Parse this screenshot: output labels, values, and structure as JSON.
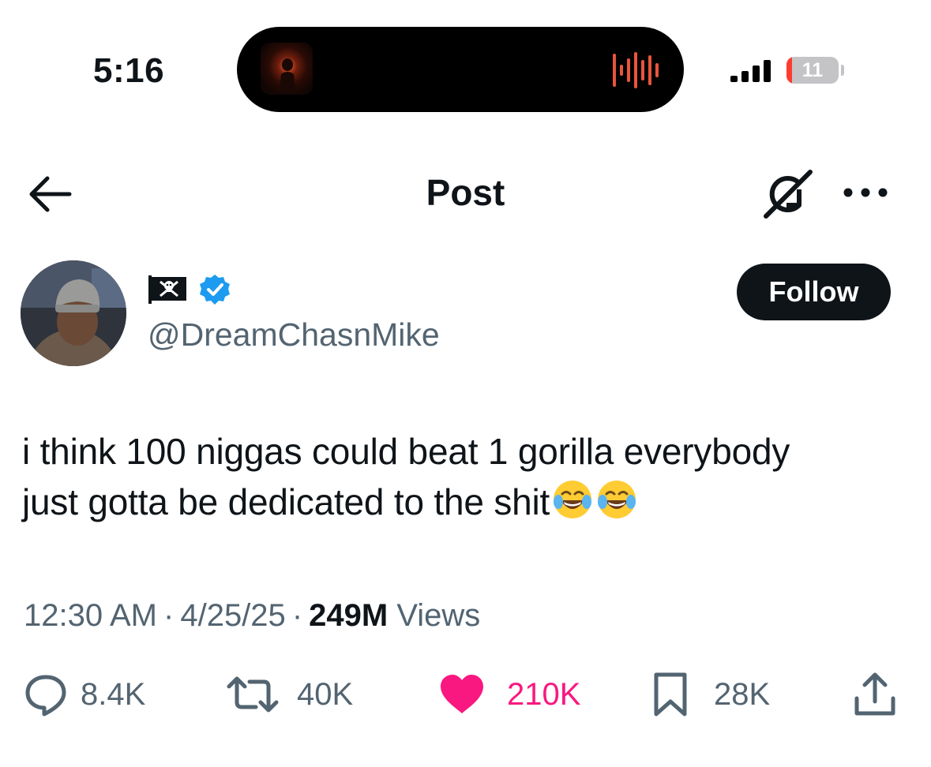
{
  "status_bar": {
    "time": "5:16",
    "battery_level": "11",
    "battery_fraction": 0.11,
    "battery_low_color": "#ff3b30",
    "island_icons": [
      "now-playing-artwork-icon",
      "audio-waveform-icon"
    ]
  },
  "header": {
    "title": "Post",
    "icons": [
      "back-arrow-icon",
      "grok-icon",
      "more-icon"
    ]
  },
  "author": {
    "display_name_icon": "pirate-flag-icon",
    "verified": true,
    "handle": "@DreamChasnMike",
    "follow_label": "Follow"
  },
  "post": {
    "line1": "i think 100 niggas could beat 1 gorilla everybody",
    "line2": "just gotta be dedicated to the shit",
    "trailing_emoji": [
      "face-with-tears-of-joy-icon",
      "face-with-tears-of-joy-icon"
    ]
  },
  "meta": {
    "time": "12:30 AM",
    "sep1": "·",
    "date": "4/25/25",
    "sep2": "·",
    "views_count": "249M",
    "views_label": "Views"
  },
  "actions": {
    "replies": "8.4K",
    "reposts": "40K",
    "likes": "210K",
    "bookmarks": "28K"
  },
  "colors": {
    "text": "#0f1419",
    "secondary": "#536471",
    "like": "#f91880",
    "verified": "#1d9bf0",
    "waveform": "#e8553d"
  }
}
